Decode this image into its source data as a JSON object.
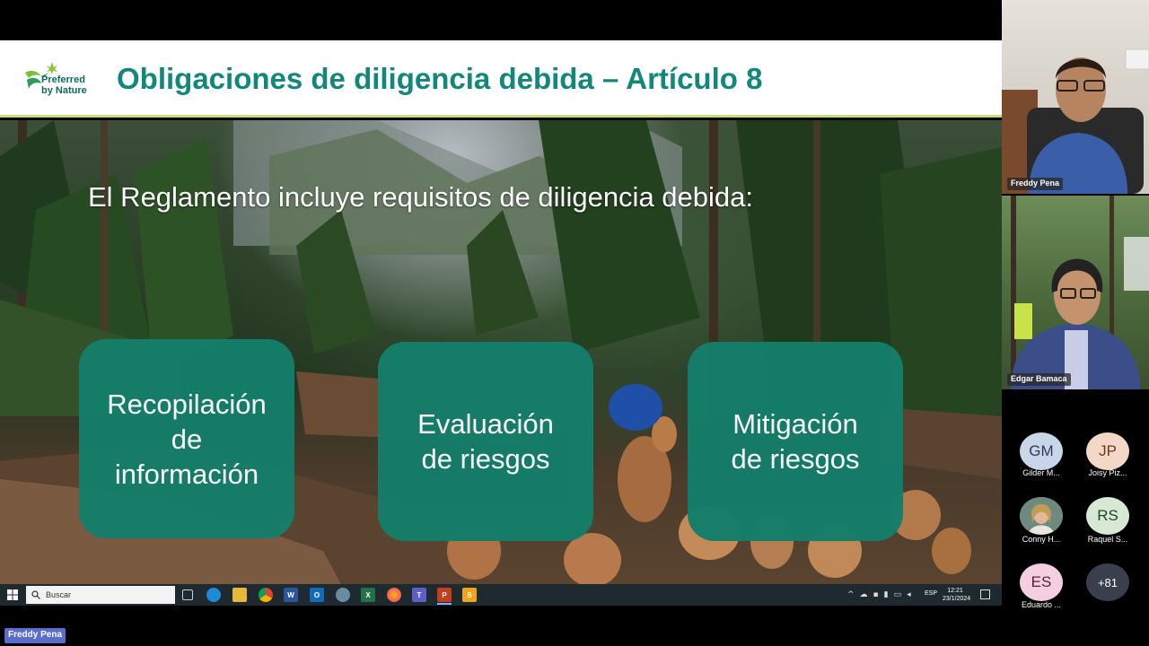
{
  "slide": {
    "logo_line1": "Preferred",
    "logo_line2": "by Nature",
    "title": "Obligaciones de diligencia debida – Artículo 8",
    "subtitle": "El Reglamento incluye requisitos de diligencia debida:",
    "cards": [
      {
        "line1": "Recopilación",
        "line2": "de",
        "line3": "información"
      },
      {
        "line1": "Evaluación",
        "line2": "de riesgos"
      },
      {
        "line1": "Mitigación",
        "line2": "de riesgos"
      }
    ],
    "colors": {
      "title": "#12877a",
      "card": "#147e6a",
      "header_bg": "#ffffff"
    }
  },
  "taskbar": {
    "search_placeholder": "Buscar",
    "language": "ESP",
    "time": "12:21",
    "date": "23/1/2024",
    "apps": [
      "task-view",
      "edge",
      "file-explorer",
      "chrome",
      "word",
      "outlook",
      "photos",
      "excel",
      "firefox",
      "teams",
      "powerpoint",
      "skype"
    ]
  },
  "meeting": {
    "presenter_label": "Freddy Pena",
    "video_tiles": [
      {
        "name": "Freddy Pena"
      },
      {
        "name": "Edgar Bamaca"
      }
    ],
    "participants": [
      {
        "initials": "GM",
        "name": "Gilder M...",
        "bg": "#c9d6ea",
        "fg": "#2e3a55"
      },
      {
        "initials": "JP",
        "name": "Joisy Piz...",
        "bg": "#f3d7c7",
        "fg": "#6a3a20"
      },
      {
        "initials": "",
        "name": "Conny H...",
        "bg": "#8aa0a6",
        "fg": "#ffffff"
      },
      {
        "initials": "RS",
        "name": "Raquel S...",
        "bg": "#d7e8d5",
        "fg": "#24442a"
      },
      {
        "initials": "ES",
        "name": "Eduardo ...",
        "bg": "#f5cfe0",
        "fg": "#5a1f3a"
      }
    ],
    "more_count": "+81"
  }
}
